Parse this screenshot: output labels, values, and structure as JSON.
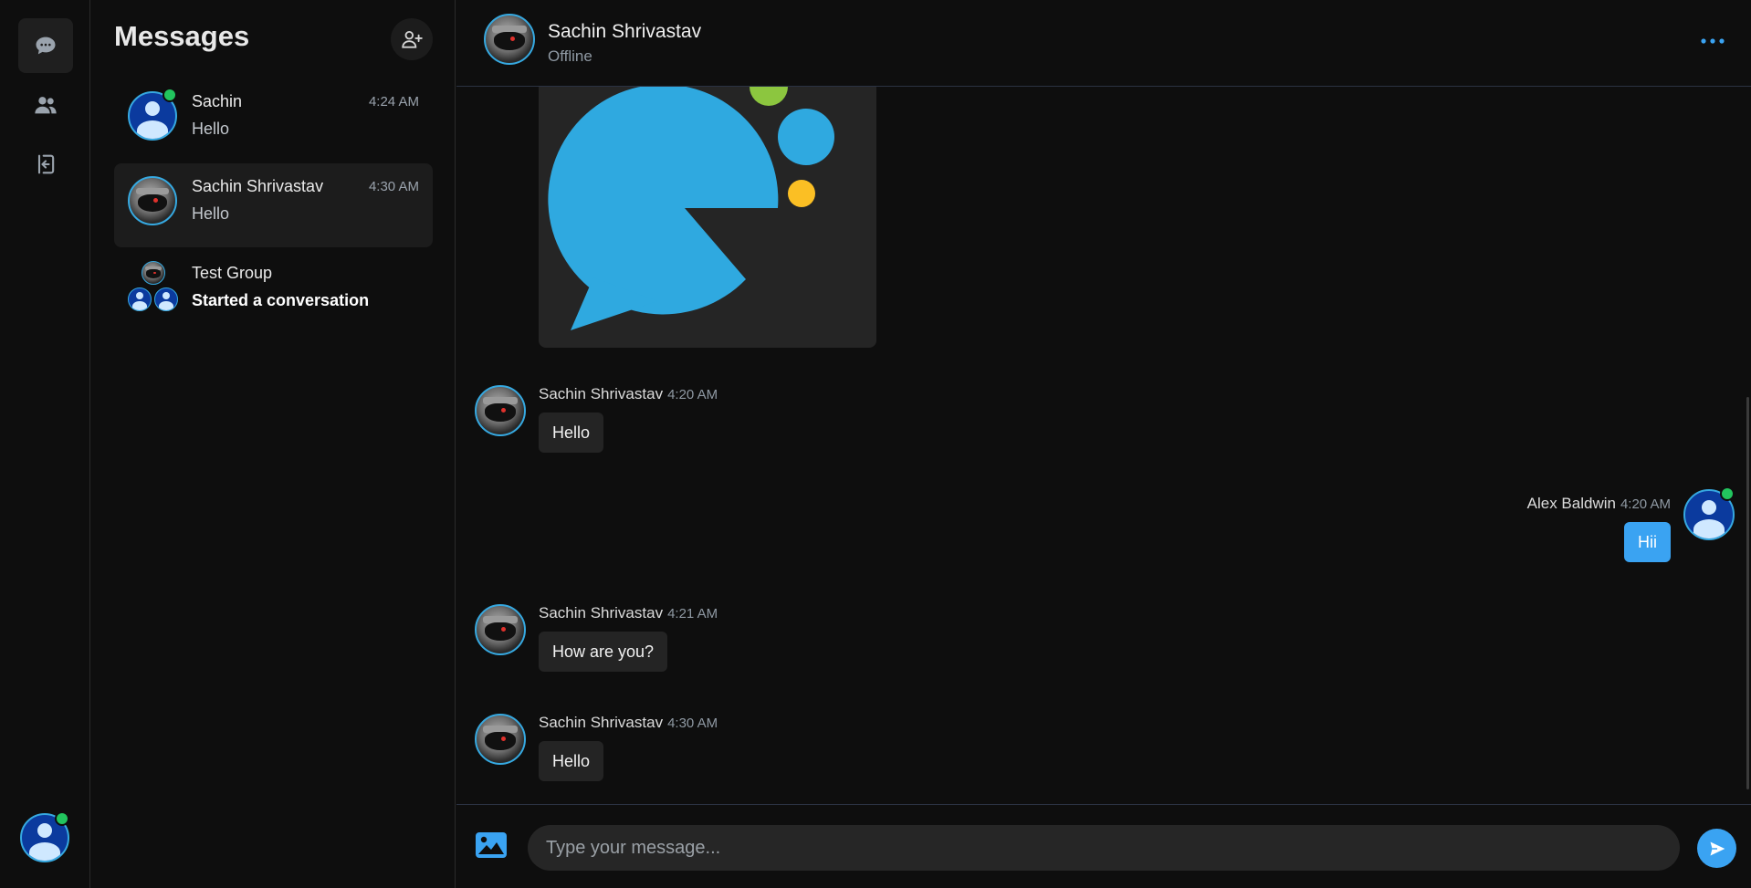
{
  "nav": {
    "items": [
      {
        "name": "chats",
        "icon": "chat-bubble-icon",
        "active": true
      },
      {
        "name": "contacts",
        "icon": "users-icon",
        "active": false
      },
      {
        "name": "logout",
        "icon": "logout-icon",
        "active": false
      }
    ],
    "current_user": {
      "avatar": "user-avatar",
      "online": true
    }
  },
  "sidebar": {
    "title": "Messages",
    "add_contact_icon": "add-user-icon",
    "conversations": [
      {
        "name": "Sachin",
        "time": "4:24 AM",
        "preview": "Hello",
        "avatar": "user-avatar",
        "online": true,
        "selected": false
      },
      {
        "name": "Sachin Shrivastav",
        "time": "4:30 AM",
        "preview": "Hello",
        "avatar": "ninja-avatar",
        "online": false,
        "selected": true
      },
      {
        "name": "Test Group",
        "time": "",
        "preview": "Started a conversation",
        "avatar": "group-avatar",
        "online": false,
        "selected": false
      }
    ]
  },
  "chat": {
    "header": {
      "name": "Sachin Shrivastav",
      "status": "Offline",
      "menu_icon": "more-horizontal-icon"
    },
    "messages": [
      {
        "sender": "Sachin Shrivastav",
        "time": "4:20 AM",
        "text": "Hello",
        "mine": false
      },
      {
        "sender": "Alex Baldwin",
        "time": "4:20 AM",
        "text": "Hii",
        "mine": true
      },
      {
        "sender": "Sachin Shrivastav",
        "time": "4:21 AM",
        "text": "How are you?",
        "mine": false
      },
      {
        "sender": "Sachin Shrivastav",
        "time": "4:30 AM",
        "text": "Hello",
        "mine": false
      }
    ],
    "composer": {
      "placeholder": "Type your message...",
      "attach_icon": "image-icon",
      "send_icon": "send-icon"
    }
  },
  "colors": {
    "accent": "#3aa3f2",
    "online": "#22c55e",
    "background": "#0e0e0e",
    "bubble": "#242424",
    "logo_blue": "#2fa9e0",
    "logo_green": "#8cc63f",
    "logo_yellow": "#fbbf24"
  }
}
